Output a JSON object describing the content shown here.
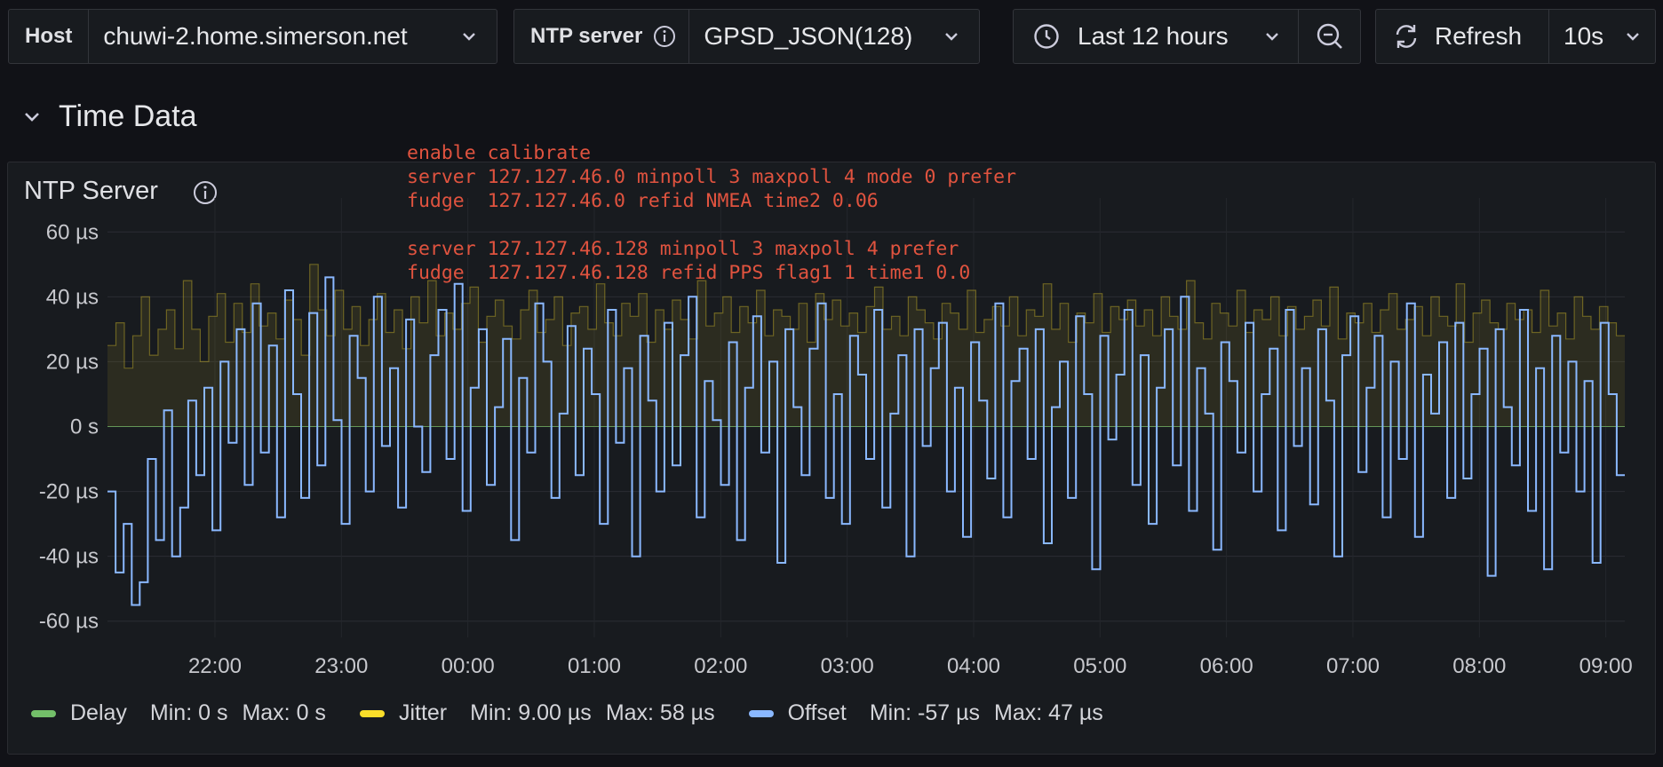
{
  "toolbar": {
    "host_label": "Host",
    "host_value": "chuwi-2.home.simerson.net",
    "ntp_label": "NTP server",
    "ntp_value": "GPSD_JSON(128)",
    "time_range": "Last 12 hours",
    "refresh_label": "Refresh",
    "refresh_interval": "10s"
  },
  "row": {
    "title": "Time Data"
  },
  "panel": {
    "title": "NTP Server",
    "notes": [
      "enable calibrate",
      "server 127.127.46.0 minpoll 3 maxpoll 4 mode 0 prefer",
      "fudge  127.127.46.0 refid NMEA time2 0.06",
      "",
      "server 127.127.46.128 minpoll 3 maxpoll 4 prefer",
      "fudge  127.127.46.128 refid PPS flag1 1 time1 0.0"
    ]
  },
  "legend": [
    {
      "name": "Delay",
      "min_label": "Min: 0 s",
      "max_label": "Max: 0 s",
      "color": "#73bf69"
    },
    {
      "name": "Jitter",
      "min_label": "Min: 9.00 µs",
      "max_label": "Max: 58 µs",
      "color": "#fade2a"
    },
    {
      "name": "Offset",
      "min_label": "Min: -57 µs",
      "max_label": "Max: 47 µs",
      "color": "#8ab8ff"
    }
  ],
  "icons": [
    "chevron-down-icon",
    "info-icon",
    "clock-icon",
    "zoom-out-icon",
    "refresh-icon"
  ],
  "chart_data": {
    "type": "line",
    "y_unit": "µs",
    "ylim": [
      -65,
      65
    ],
    "y_ticks": [
      "60 µs",
      "40 µs",
      "20 µs",
      "0 s",
      "-20 µs",
      "-40 µs",
      "-60 µs"
    ],
    "y_tick_values": [
      60,
      40,
      20,
      0,
      -20,
      -40,
      -60
    ],
    "x_ticks": [
      "22:00",
      "23:00",
      "00:00",
      "01:00",
      "02:00",
      "03:00",
      "04:00",
      "05:00",
      "06:00",
      "07:00",
      "08:00",
      "09:00"
    ],
    "x_range_hours": [
      21.15,
      33.15
    ],
    "grid": true,
    "legend_position": "bottom",
    "series": [
      {
        "name": "Delay",
        "color": "#73bf69",
        "style": "flat",
        "values": [
          0,
          0,
          0,
          0,
          0,
          0,
          0,
          0,
          0,
          0,
          0,
          0,
          0,
          0,
          0,
          0,
          0,
          0,
          0,
          0,
          0,
          0,
          0,
          0,
          0,
          0,
          0,
          0,
          0,
          0,
          0,
          0,
          0,
          0,
          0,
          0,
          0,
          0,
          0,
          0,
          0,
          0,
          0,
          0,
          0,
          0,
          0,
          0,
          0
        ]
      },
      {
        "name": "Jitter",
        "color": "#fade2a",
        "style": "step-area",
        "values": [
          25,
          32,
          18,
          28,
          40,
          22,
          30,
          36,
          24,
          45,
          30,
          20,
          34,
          41,
          26,
          38,
          29,
          44,
          31,
          35,
          27,
          39,
          33,
          22,
          50,
          36,
          28,
          42,
          30,
          37,
          25,
          33,
          41,
          29,
          36,
          24,
          40,
          32,
          45,
          28,
          35,
          30,
          38,
          43,
          26,
          34,
          39,
          31,
          27,
          36,
          42,
          29,
          33,
          40,
          25,
          35,
          37,
          30,
          44,
          32,
          28,
          38,
          34,
          41,
          26,
          36,
          30,
          39,
          33,
          27,
          45,
          31,
          35,
          40,
          29,
          37,
          32,
          42,
          28,
          36,
          34,
          30,
          38,
          26,
          41,
          33,
          39,
          31,
          35,
          29,
          37,
          43,
          30,
          34,
          28,
          40,
          36,
          32,
          27,
          38,
          35,
          30,
          42,
          29,
          33,
          37,
          31,
          40,
          28,
          36,
          34,
          44,
          30,
          38,
          26,
          35,
          32,
          41,
          29,
          37,
          33,
          39,
          31,
          36,
          28,
          40,
          34,
          30,
          45,
          32,
          27,
          38,
          35,
          31,
          42,
          29,
          36,
          33,
          40,
          28,
          37,
          30,
          34,
          39,
          31,
          43,
          27,
          35,
          32,
          38,
          29,
          36,
          41,
          30,
          33,
          37,
          28,
          40,
          34,
          31,
          44,
          26,
          35,
          39,
          32,
          30,
          38,
          33,
          36,
          29,
          42,
          31,
          35,
          27,
          40,
          34,
          30,
          37,
          32,
          28
        ]
      },
      {
        "name": "Offset",
        "color": "#8ab8ff",
        "style": "step",
        "values": [
          -20,
          -45,
          -30,
          -55,
          -48,
          -10,
          -35,
          5,
          -40,
          -25,
          8,
          -15,
          12,
          -32,
          20,
          -5,
          30,
          -18,
          38,
          -8,
          25,
          -28,
          42,
          10,
          -22,
          35,
          -12,
          46,
          2,
          -30,
          28,
          15,
          -20,
          40,
          -6,
          18,
          -25,
          33,
          0,
          -14,
          22,
          36,
          -10,
          44,
          -26,
          12,
          30,
          -18,
          6,
          27,
          -35,
          15,
          -8,
          38,
          20,
          -22,
          4,
          31,
          -15,
          24,
          10,
          -30,
          36,
          -5,
          18,
          -40,
          28,
          8,
          -20,
          32,
          -12,
          22,
          40,
          -28,
          14,
          2,
          -18,
          26,
          -35,
          12,
          34,
          -8,
          20,
          -42,
          30,
          6,
          -15,
          24,
          38,
          -22,
          10,
          -30,
          28,
          16,
          -10,
          36,
          -25,
          4,
          22,
          -40,
          30,
          -6,
          18,
          32,
          -20,
          12,
          -34,
          26,
          8,
          -16,
          38,
          -28,
          14,
          24,
          -10,
          30,
          -36,
          6,
          20,
          -22,
          34,
          10,
          -44,
          28,
          -4,
          16,
          36,
          -18,
          22,
          -30,
          12,
          30,
          -12,
          40,
          -26,
          18,
          4,
          -38,
          26,
          14,
          -8,
          32,
          -20,
          10,
          24,
          -32,
          36,
          -6,
          18,
          -24,
          30,
          8,
          -40,
          22,
          34,
          -14,
          12,
          28,
          -28,
          20,
          -10,
          38,
          -34,
          16,
          4,
          26,
          -22,
          32,
          -16,
          10,
          24,
          -46,
          30,
          6,
          -12,
          36,
          -26,
          18,
          -44,
          28,
          -8,
          20,
          -20,
          14,
          -42,
          32,
          10,
          -15
        ]
      }
    ]
  }
}
